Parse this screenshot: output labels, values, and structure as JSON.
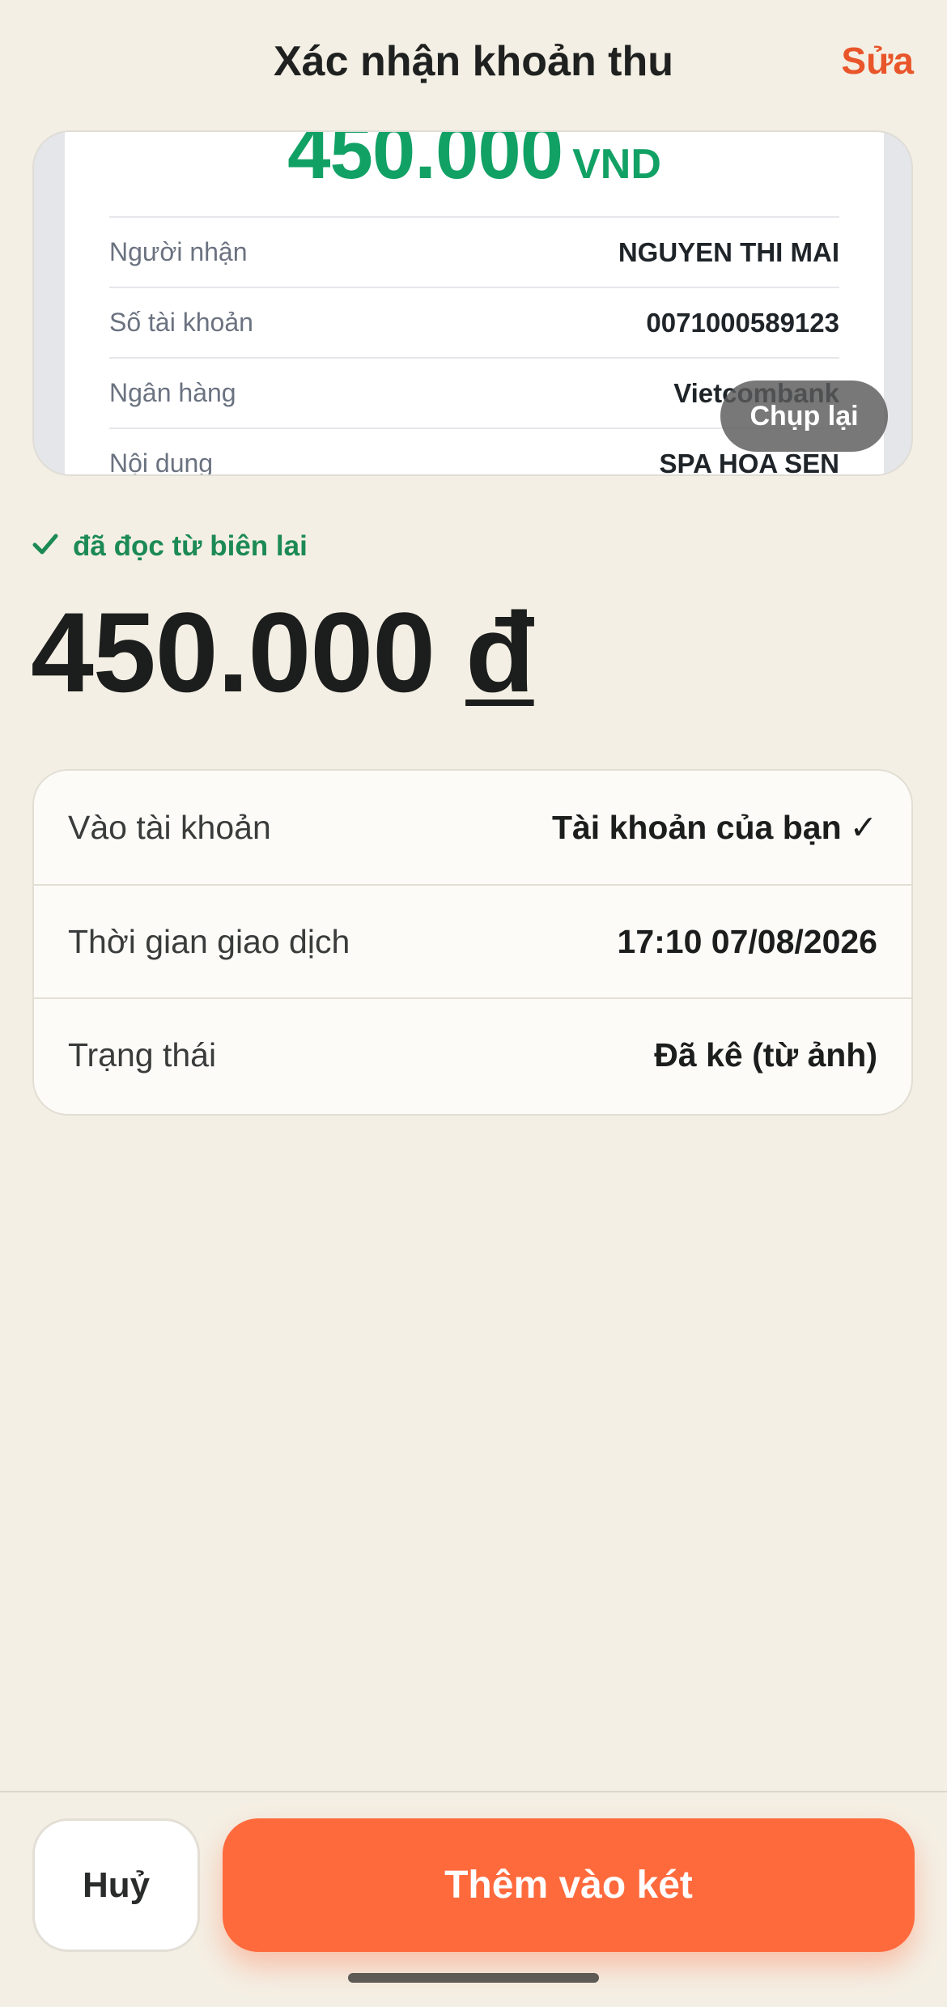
{
  "header": {
    "title": "Xác nhận khoản thu",
    "edit_label": "Sửa"
  },
  "receipt": {
    "amount": "450.000",
    "currency": "VND",
    "rows": [
      {
        "label": "Người nhận",
        "value": "NGUYEN THI MAI"
      },
      {
        "label": "Số tài khoản",
        "value": "0071000589123"
      },
      {
        "label": "Ngân hàng",
        "value": "Vietcombank"
      },
      {
        "label": "Nội dung",
        "value": "SPA HOA SEN"
      }
    ],
    "retake_label": "Chụp lại"
  },
  "ocr_note": "đã đọc từ biên lai",
  "amount": {
    "value": "450.000",
    "currency": "đ"
  },
  "details": [
    {
      "label": "Vào tài khoản",
      "value": "Tài khoản của bạn",
      "check": "✓"
    },
    {
      "label": "Thời gian giao dịch",
      "value": "17:10 07/08/2026"
    },
    {
      "label": "Trạng thái",
      "value": "Đã kê (từ ảnh)"
    }
  ],
  "footer": {
    "cancel_label": "Huỷ",
    "confirm_label": "Thêm vào két"
  },
  "colors": {
    "accent": "#ff6a3d",
    "edit": "#e9552a",
    "success": "#1c8a55",
    "receipt_amount": "#12a165",
    "background": "#f4efe4"
  }
}
